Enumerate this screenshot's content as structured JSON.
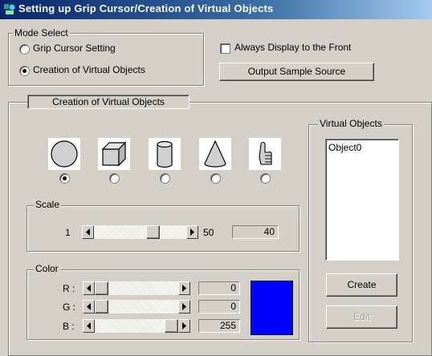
{
  "window": {
    "title": "Setting up Grip Cursor/Creation of Virtual Objects",
    "icon": "app-icon"
  },
  "mode_select": {
    "legend": "Mode Select",
    "options": [
      {
        "label": "Grip Cursor Setting",
        "selected": false
      },
      {
        "label": "Creation of Virtual Objects",
        "selected": true
      }
    ]
  },
  "always_front": {
    "label": "Always Display to the Front",
    "checked": false
  },
  "output_button": {
    "label": "Output Sample Source"
  },
  "tab": {
    "label": "Creation of Virtual Objects"
  },
  "shapes": [
    {
      "name": "sphere-icon",
      "selected": true
    },
    {
      "name": "cube-icon",
      "selected": false
    },
    {
      "name": "cylinder-icon",
      "selected": false
    },
    {
      "name": "cone-icon",
      "selected": false
    },
    {
      "name": "hand-icon",
      "selected": false
    }
  ],
  "scale": {
    "legend": "Scale",
    "min_label": "1",
    "max_label": "50",
    "value": "40",
    "position": 40,
    "min": 1,
    "max": 50
  },
  "color": {
    "legend": "Color",
    "channels": [
      {
        "label": "R :",
        "value": "0",
        "position": 0
      },
      {
        "label": "G :",
        "value": "0",
        "position": 0
      },
      {
        "label": "B :",
        "value": "255",
        "position": 255
      }
    ],
    "preview": "#0000ff"
  },
  "virtual_objects": {
    "legend": "Virtual Objects",
    "items": [
      "Object0"
    ]
  },
  "create_button": {
    "label": "Create"
  },
  "edit_button": {
    "label": "Edit",
    "disabled": true
  }
}
